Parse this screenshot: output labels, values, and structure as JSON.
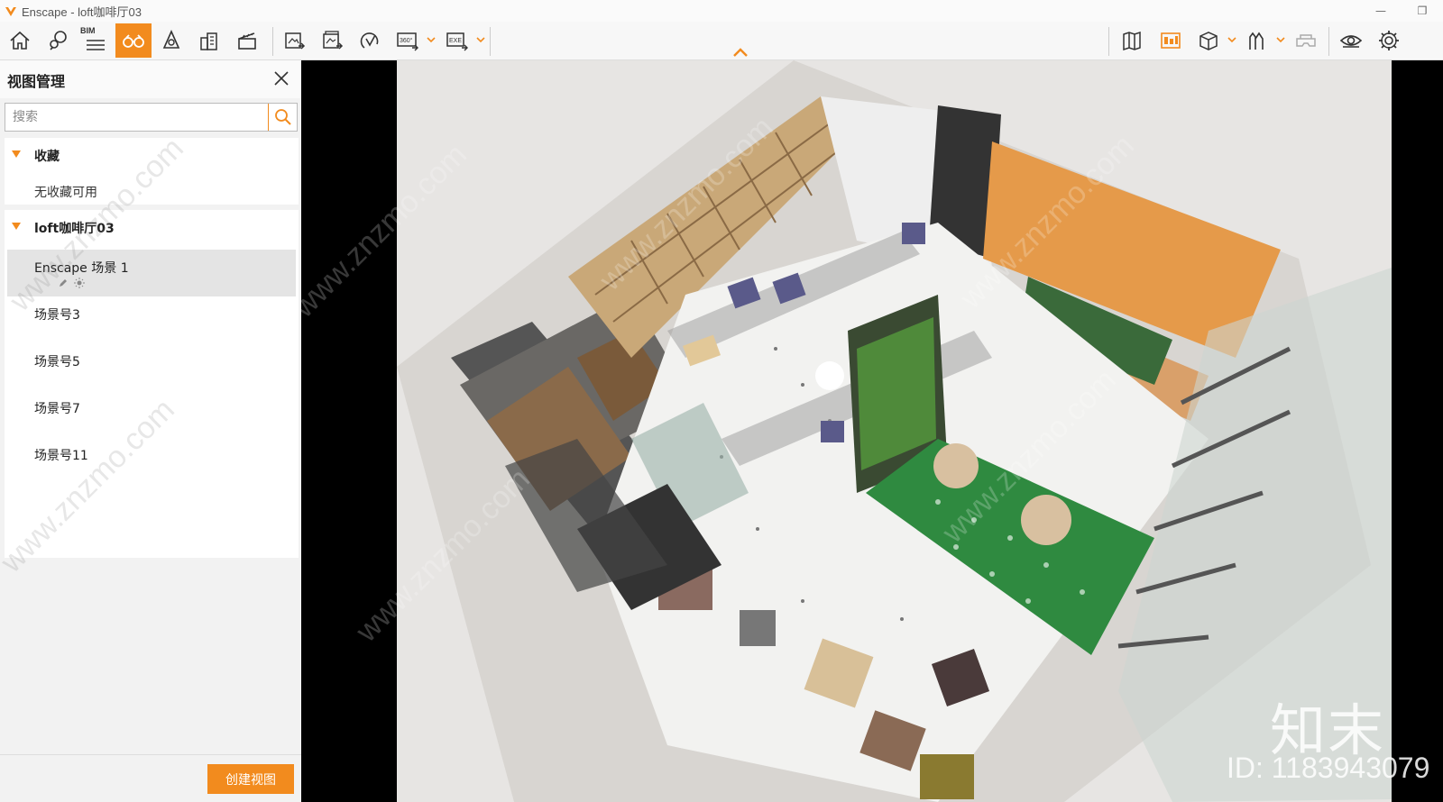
{
  "window": {
    "title": "Enscape - loft咖啡厅03",
    "minimize_glyph": "—",
    "restore_glyph": "❐"
  },
  "toolbar": {
    "bim_label": "BIM",
    "buttons_left": [
      "home-icon",
      "pin-location-icon",
      "bim-list-icon",
      "binoculars-icon",
      "light-view-icon",
      "buildings-icon",
      "clapper-icon"
    ],
    "buttons_export": [
      "screenshot-export-icon",
      "batch-render-icon",
      "upload-icon",
      "panorama-360-icon",
      "exe-export-icon"
    ],
    "buttons_right": [
      "map-icon",
      "sketch-icon",
      "cube-icon",
      "people-icon",
      "vr-headset-icon",
      "eye-icon",
      "gear-icon"
    ],
    "accent": "#f28b1e"
  },
  "panel": {
    "title": "视图管理",
    "search_placeholder": "搜索",
    "favorites": {
      "label": "收藏",
      "empty_text": "无收藏可用"
    },
    "project": {
      "label": "loft咖啡厅03",
      "views": [
        {
          "label": "Enscape 场景 1",
          "selected": true
        },
        {
          "label": "场景号3",
          "selected": false
        },
        {
          "label": "场景号5",
          "selected": false
        },
        {
          "label": "场景号7",
          "selected": false
        },
        {
          "label": "场景号11",
          "selected": false
        }
      ]
    },
    "create_button": "创建视图"
  },
  "watermark": {
    "brand": "知末",
    "id_text": "ID: 1183943079",
    "diagonal_text": "www.znzmo.com"
  }
}
